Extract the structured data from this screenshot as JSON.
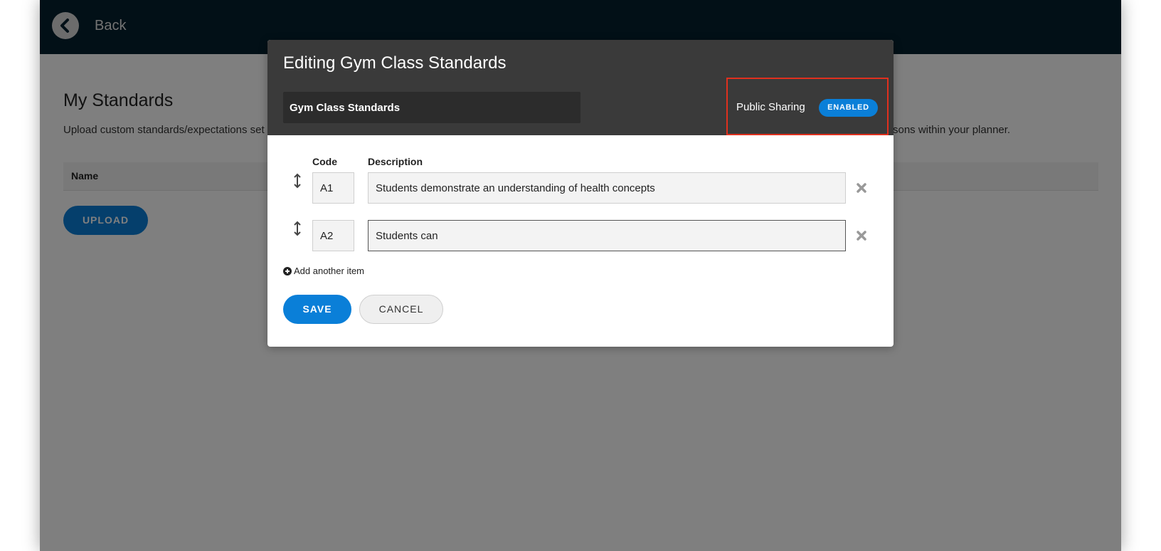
{
  "header": {
    "back_label": "Back",
    "back_icon": "chevron-left-icon"
  },
  "page": {
    "title": "My Standards",
    "description_start": "Upload custom standards/expectations set",
    "description_end": "sons within your planner.",
    "table_column_name": "Name",
    "upload_label": "UPLOAD"
  },
  "modal": {
    "title": "Editing Gym Class Standards",
    "name_value": "Gym Class Standards",
    "public_sharing_label": "Public Sharing",
    "public_sharing_status": "ENABLED",
    "columns": {
      "code": "Code",
      "description": "Description"
    },
    "items": [
      {
        "code": "A1",
        "description": "Students demonstrate an understanding of health concepts"
      },
      {
        "code": "A2",
        "description": "Students can"
      }
    ],
    "add_item_label": "Add another item",
    "save_label": "SAVE",
    "cancel_label": "CANCEL"
  },
  "colors": {
    "header_bg": "#04212e",
    "modal_header_bg": "#3a3a3a",
    "accent_blue": "#0a7fd8",
    "highlight_red": "#e0301e"
  }
}
